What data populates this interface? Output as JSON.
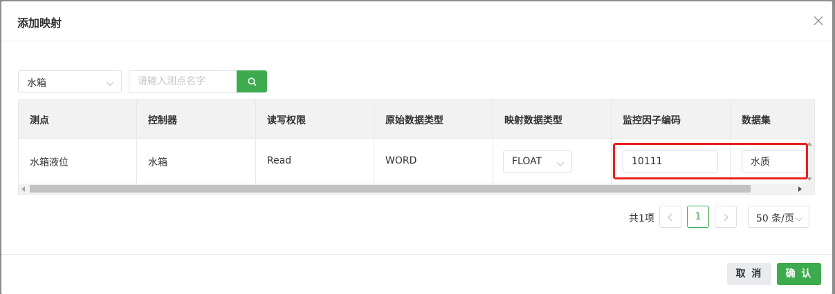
{
  "dialog": {
    "title": "添加映射"
  },
  "toolbar": {
    "controller_select": "水箱",
    "search_placeholder": "请输入测点名字"
  },
  "table": {
    "columns": [
      "测点",
      "控制器",
      "读写权限",
      "原始数据类型",
      "映射数据类型",
      "监控因子编码",
      "数据集"
    ],
    "rows": [
      {
        "point": "水箱液位",
        "controller": "水箱",
        "permission": "Read",
        "raw_type": "WORD",
        "mapped_type": "FLOAT",
        "factor_code": "10111",
        "dataset": "水质"
      }
    ]
  },
  "pagination": {
    "total": "共1项",
    "current_page": "1",
    "page_size": "50 条/页"
  },
  "footer": {
    "cancel_label": "取 消",
    "ok_label": "确 认"
  },
  "colors": {
    "primary": "#3daa4e",
    "highlight": "#e8201c"
  },
  "icons": {
    "close": "close-icon",
    "search": "search-icon",
    "dropdown": "chevron-down-icon",
    "prev": "chevron-left-icon",
    "next": "chevron-right-icon"
  }
}
